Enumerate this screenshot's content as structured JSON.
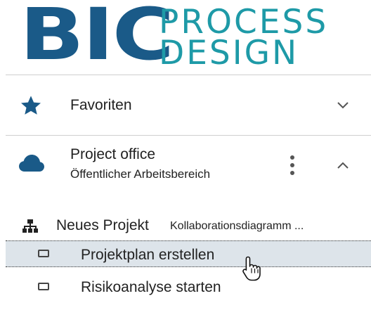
{
  "logo": {
    "bic": "BIC",
    "line1": "PROCESS",
    "line2": "DESIGN",
    "colors": {
      "bic": "#1a5a88",
      "text": "#1e9aa7"
    }
  },
  "favorites": {
    "label": "Favoriten",
    "icon": "star-icon",
    "toggle_icon": "chevron-down-icon"
  },
  "workspace": {
    "title": "Project office",
    "subtitle": "Öffentlicher Arbeitsbereich",
    "icon": "cloud-icon",
    "menu_icon": "more-vertical-icon",
    "toggle_icon": "chevron-up-icon"
  },
  "tree": {
    "diagram": {
      "name": "Neues Projekt",
      "type": "Kollaborationsdiagramm ...",
      "icon": "hierarchy-icon"
    },
    "items": [
      {
        "label": "Projektplan erstellen",
        "icon": "task-icon",
        "selected": true
      },
      {
        "label": "Risikoanalyse starten",
        "icon": "task-icon",
        "selected": false
      }
    ]
  },
  "cursor": "hand-pointer-icon"
}
